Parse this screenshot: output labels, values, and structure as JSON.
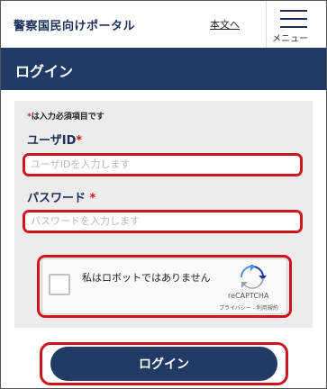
{
  "header": {
    "site_title": "警察国民向けポータル",
    "skip_link": "本文へ",
    "menu_label": "メニュー"
  },
  "page": {
    "title": "ログイン"
  },
  "form": {
    "required_note_marker": "*",
    "required_note": "は入力必須項目です",
    "user_id_label": "ユーザID",
    "user_id_marker": "*",
    "user_id_placeholder": "ユーザIDを入力します",
    "password_label": "パスワード",
    "password_marker": " *",
    "password_placeholder": "パスワードを入力します"
  },
  "recaptcha": {
    "checkbox_text": "私はロボットではありません",
    "brand": "reCAPTCHA",
    "links": "プライバシー - 利用規約",
    "logo_icon": "recaptcha-logo-icon"
  },
  "actions": {
    "login_label": "ログイン"
  },
  "colors": {
    "navy": "#223a66",
    "required_red": "#d0141e",
    "panel_gray": "#ececec"
  }
}
